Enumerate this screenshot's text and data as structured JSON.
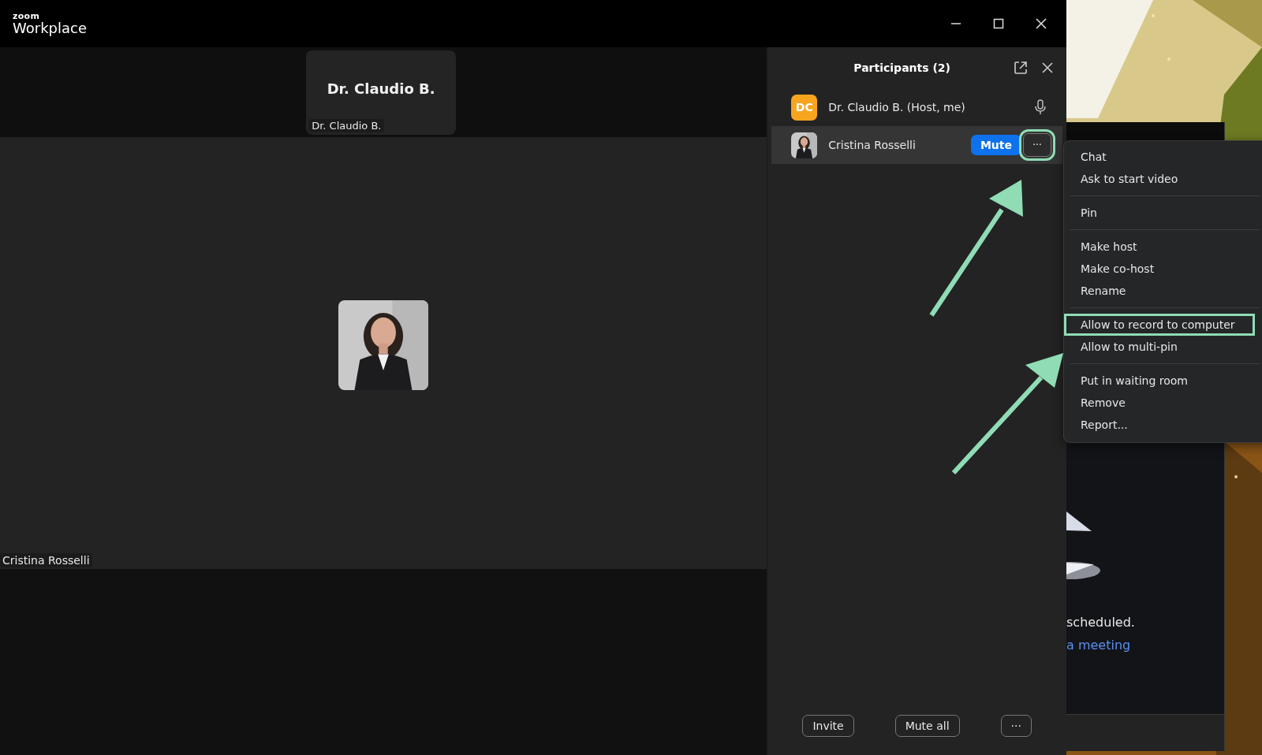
{
  "window": {
    "logo_small": "zoom",
    "logo_title": "Workplace"
  },
  "video": {
    "top_tile": {
      "name": "Dr. Claudio B.",
      "label": "Dr. Claudio B."
    },
    "main_label": "Cristina Rosselli"
  },
  "participants": {
    "title": "Participants (2)",
    "rows": [
      {
        "initials": "DC",
        "name": "Dr. Claudio B. (Host, me)",
        "kind": "initials",
        "hovered": false
      },
      {
        "name": "Cristina Rosselli",
        "hovered": true,
        "mute_button": "Mute",
        "more_button": "···",
        "more_annotated": true
      }
    ],
    "footer_buttons": [
      {
        "label": "Invite"
      },
      {
        "label": "Mute all"
      },
      {
        "label": "···"
      }
    ]
  },
  "context_menu": {
    "groups": [
      [
        {
          "label": "Chat",
          "annotated": false
        },
        {
          "label": "Ask to start video",
          "annotated": false
        }
      ],
      [
        {
          "label": "Pin",
          "annotated": false
        }
      ],
      [
        {
          "label": "Make host",
          "annotated": false
        },
        {
          "label": "Make co-host",
          "annotated": false
        },
        {
          "label": "Rename",
          "annotated": false
        }
      ],
      [
        {
          "label": "Allow to record to computer",
          "annotated": true
        },
        {
          "label": "Allow to multi-pin",
          "annotated": false
        }
      ],
      [
        {
          "label": "Put in waiting room",
          "annotated": false
        },
        {
          "label": "Remove",
          "annotated": false
        },
        {
          "label": "Report...",
          "annotated": false
        }
      ]
    ]
  },
  "background_app": {
    "message": "scheduled.",
    "link": "a meeting"
  }
}
